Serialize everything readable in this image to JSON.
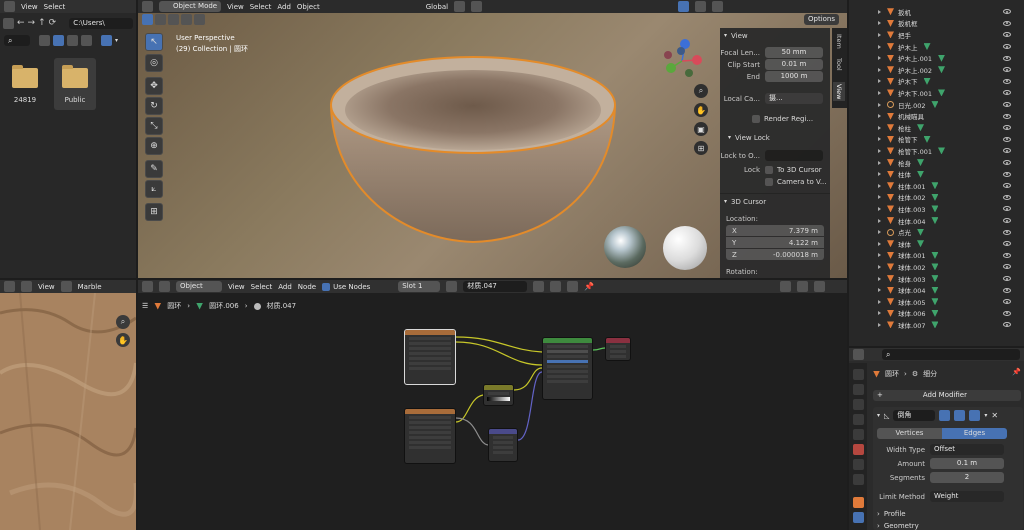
{
  "file_browser": {
    "menu": {
      "view": "View",
      "select": "Select"
    },
    "path": "C:\\Users\\",
    "folders": [
      {
        "name": "24819"
      },
      {
        "name": "Public"
      }
    ]
  },
  "viewport": {
    "mode": "Object Mode",
    "menu": {
      "view": "View",
      "select": "Select",
      "add": "Add",
      "object": "Object"
    },
    "orientation": "Global",
    "options": "Options",
    "perspective": "User Perspective",
    "collection": "(29) Collection | 圆环",
    "tabs": {
      "item": "Item",
      "tool": "Tool",
      "view": "View"
    }
  },
  "view_panel": {
    "title": "View",
    "focal_length": {
      "label": "Focal Len...",
      "value": "50 mm"
    },
    "clip_start": {
      "label": "Clip Start",
      "value": "0.01 m"
    },
    "clip_end": {
      "label": "End",
      "value": "1000 m"
    },
    "local_camera": {
      "label": "Local Ca...",
      "value": "摄..."
    },
    "render_region": "Render Regi...",
    "view_lock_title": "View Lock",
    "lock_to_object": "Lock to O...",
    "lock": "Lock",
    "to_3d_cursor": "To 3D Cursor",
    "camera_to_view": "Camera to V...",
    "cursor_title": "3D Cursor",
    "location_label": "Location:",
    "x": {
      "label": "X",
      "value": "7.379 m"
    },
    "y": {
      "label": "Y",
      "value": "4.122 m"
    },
    "z": {
      "label": "Z",
      "value": "-0.000018 m"
    },
    "rotation_label": "Rotation:"
  },
  "image_editor": {
    "view": "View",
    "image_name": "Marble"
  },
  "node_editor": {
    "type": "Object",
    "menu": {
      "view": "View",
      "select": "Select",
      "add": "Add",
      "node": "Node"
    },
    "use_nodes": "Use Nodes",
    "slot": "Slot 1",
    "material": "材质.047",
    "breadcrumb": [
      "圆环",
      "圆环.006",
      "材质.047"
    ]
  },
  "outliner": {
    "items": [
      {
        "name": "扳机",
        "kind": "mesh",
        "green": false
      },
      {
        "name": "扳机框",
        "kind": "mesh",
        "green": false
      },
      {
        "name": "把手",
        "kind": "mesh",
        "green": false
      },
      {
        "name": "护木上",
        "kind": "mesh",
        "green": true
      },
      {
        "name": "护木上.001",
        "kind": "mesh",
        "green": true
      },
      {
        "name": "护木上.002",
        "kind": "mesh",
        "green": true
      },
      {
        "name": "护木下",
        "kind": "mesh",
        "green": true
      },
      {
        "name": "护木下.001",
        "kind": "mesh",
        "green": true
      },
      {
        "name": "日光.002",
        "kind": "light",
        "green": true
      },
      {
        "name": "机械瞄具",
        "kind": "mesh",
        "green": false
      },
      {
        "name": "枪柱",
        "kind": "mesh",
        "green": true
      },
      {
        "name": "枪管下",
        "kind": "mesh",
        "green": true
      },
      {
        "name": "枪管下.001",
        "kind": "mesh",
        "green": true
      },
      {
        "name": "枪身",
        "kind": "mesh",
        "green": true
      },
      {
        "name": "柱体",
        "kind": "mesh",
        "green": true
      },
      {
        "name": "柱体.001",
        "kind": "mesh",
        "green": true
      },
      {
        "name": "柱体.002",
        "kind": "mesh",
        "green": true
      },
      {
        "name": "柱体.003",
        "kind": "mesh",
        "green": true
      },
      {
        "name": "柱体.004",
        "kind": "mesh",
        "green": true
      },
      {
        "name": "点光",
        "kind": "light",
        "green": true
      },
      {
        "name": "球体",
        "kind": "mesh",
        "green": true
      },
      {
        "name": "球体.001",
        "kind": "mesh",
        "green": true
      },
      {
        "name": "球体.002",
        "kind": "mesh",
        "green": true
      },
      {
        "name": "球体.003",
        "kind": "mesh",
        "green": true
      },
      {
        "name": "球体.004",
        "kind": "mesh",
        "green": true
      },
      {
        "name": "球体.005",
        "kind": "mesh",
        "green": true
      },
      {
        "name": "球体.006",
        "kind": "mesh",
        "green": true
      },
      {
        "name": "球体.007",
        "kind": "mesh",
        "green": true
      }
    ]
  },
  "properties": {
    "breadcrumb_object": "圆环",
    "breadcrumb_modifier": "细分",
    "add_modifier": "Add Modifier",
    "modifier_name": "倒角",
    "vertices": "Vertices",
    "edges": "Edges",
    "width_type": {
      "label": "Width Type",
      "value": "Offset"
    },
    "amount": {
      "label": "Amount",
      "value": "0.1 m"
    },
    "segments": {
      "label": "Segments",
      "value": "2"
    },
    "limit_method": {
      "label": "Limit Method",
      "value": "Weight"
    },
    "profile": "Profile",
    "geometry": "Geometry"
  }
}
